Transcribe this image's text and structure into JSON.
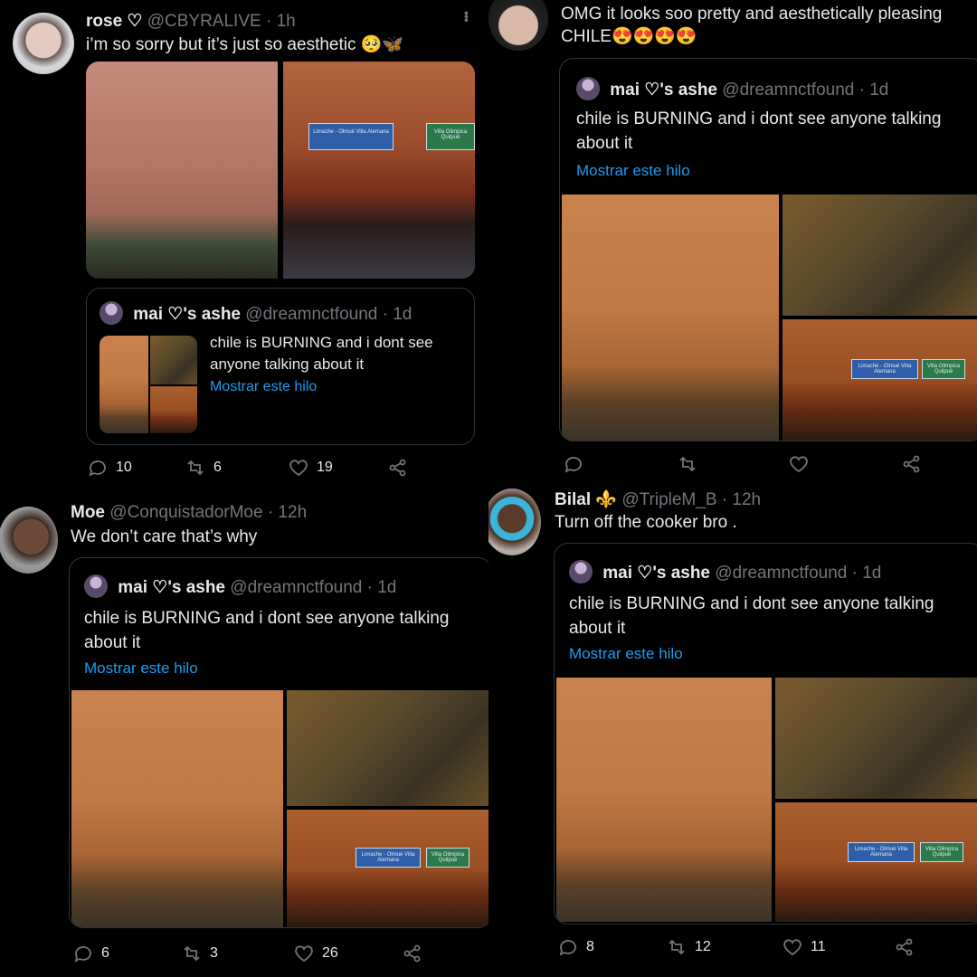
{
  "tweets": [
    {
      "name": "rose ♡",
      "handle": "@CBYRALIVE",
      "time": "· 1h",
      "text": "i’m so sorry but it’s just so aesthetic 🥺🦋",
      "actions": {
        "reply": "10",
        "retweet": "6",
        "like": "19"
      }
    },
    {
      "text": "OMG it looks soo pretty and aesthetically pleasing CHILE😍😍😍😍",
      "actions": {
        "reply": "",
        "retweet": "",
        "like": ""
      }
    },
    {
      "name": "Moe",
      "handle": "@ConquistadorMoe",
      "time": "· 12h",
      "text": "We don’t care that’s why",
      "actions": {
        "reply": "6",
        "retweet": "3",
        "like": "26"
      }
    },
    {
      "name": "Bilal ⚜️",
      "handle": "@TripleM_B",
      "time": "· 12h",
      "text": "Turn off the cooker bro .",
      "actions": {
        "reply": "8",
        "retweet": "12",
        "like": "11"
      }
    }
  ],
  "quoted": {
    "name": "mai ♡'s ashe",
    "handle": "@dreamnctfound",
    "time": "· 1d",
    "text": "chile is BURNING and i dont see anyone talking about it",
    "show_thread": "Mostrar este hilo"
  },
  "signs": {
    "left": "Limache - Olmué Villa Alemana",
    "right": "Villa Olimpica Quilpué"
  },
  "colors": {
    "link": "#1d9bf0",
    "muted": "#71767b",
    "background": "#000000"
  }
}
